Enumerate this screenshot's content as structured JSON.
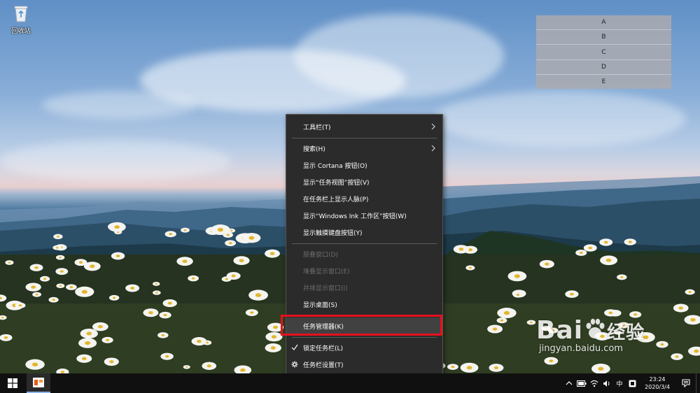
{
  "desktop": {
    "recycle_bin_label": "回收站"
  },
  "annotation_panel": {
    "rows": [
      "A",
      "B",
      "C",
      "D",
      "E"
    ]
  },
  "context_menu": {
    "items": [
      {
        "label": "工具栏(T)",
        "submenu": true,
        "enabled": true
      },
      {
        "label": "搜索(H)",
        "submenu": true,
        "enabled": true
      },
      {
        "label": "显示 Cortana 按钮(O)",
        "enabled": true
      },
      {
        "label": "显示“任务视图”按钮(V)",
        "enabled": true
      },
      {
        "label": "在任务栏上显示人脉(P)",
        "enabled": true
      },
      {
        "label": "显示“Windows Ink 工作区”按钮(W)",
        "enabled": true
      },
      {
        "label": "显示触摸键盘按钮(Y)",
        "enabled": true
      },
      {
        "label": "层叠窗口(D)",
        "enabled": false
      },
      {
        "label": "堆叠显示窗口(E)",
        "enabled": false
      },
      {
        "label": "并排显示窗口(I)",
        "enabled": false
      },
      {
        "label": "显示桌面(S)",
        "enabled": true
      },
      {
        "label": "任务管理器(K)",
        "enabled": true,
        "highlighted": true
      },
      {
        "label": "锁定任务栏(L)",
        "enabled": true,
        "checked": true
      },
      {
        "label": "任务栏设置(T)",
        "enabled": true,
        "icon": "gear-icon"
      }
    ]
  },
  "taskbar": {
    "tray": {
      "ime_label": "中",
      "time": "23:24",
      "date": "2020/3/4"
    },
    "icons": [
      "windows-start-icon",
      "app-icon",
      "chevron-up-icon",
      "battery-icon",
      "network-icon",
      "volume-icon",
      "ime-icon",
      "input-mode-icon",
      "notification-icon"
    ]
  },
  "watermark": {
    "logo_text": "Bai",
    "logo_text2": "经验",
    "url": "jingyan.baidu.com"
  },
  "colors": {
    "menu_bg": "#2b2b2b",
    "menu_hover": "#414141",
    "highlight_border": "#e8101e",
    "taskbar_bg": "#101010"
  }
}
